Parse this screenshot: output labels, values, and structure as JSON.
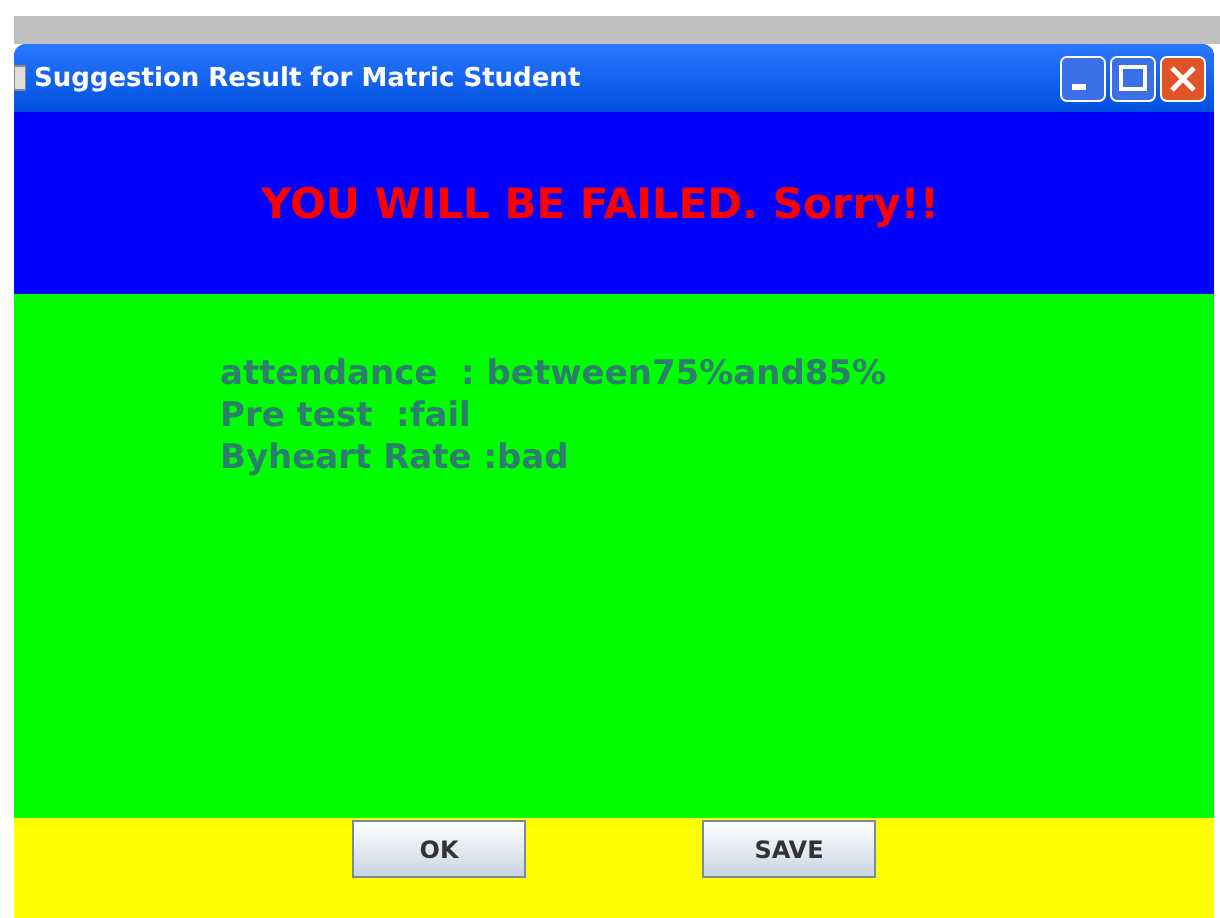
{
  "window": {
    "title": "Suggestion Result for Matric Student"
  },
  "headline": "YOU WILL BE FAILED. Sorry!!",
  "results": [
    "attendance  : between75%and85%",
    "Pre test  :fail",
    "Byheart Rate :bad"
  ],
  "buttons": [
    "OK",
    "SAVE"
  ]
}
